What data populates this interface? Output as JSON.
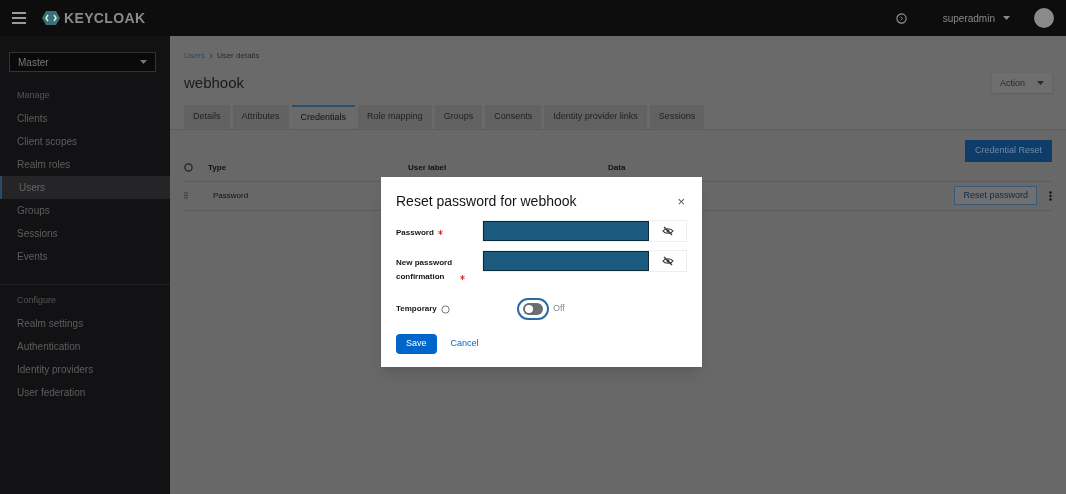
{
  "header": {
    "brand": "KEYCLOAK",
    "user": "superadmin"
  },
  "sidebar": {
    "realm": "Master",
    "sections": [
      {
        "title": "Manage",
        "items": [
          {
            "label": "Clients",
            "selected": false
          },
          {
            "label": "Client scopes",
            "selected": false
          },
          {
            "label": "Realm roles",
            "selected": false
          },
          {
            "label": "Users",
            "selected": true
          },
          {
            "label": "Groups",
            "selected": false
          },
          {
            "label": "Sessions",
            "selected": false
          },
          {
            "label": "Events",
            "selected": false
          }
        ]
      },
      {
        "title": "Configure",
        "items": [
          {
            "label": "Realm settings",
            "selected": false
          },
          {
            "label": "Authentication",
            "selected": false
          },
          {
            "label": "Identity providers",
            "selected": false
          },
          {
            "label": "User federation",
            "selected": false
          }
        ]
      }
    ]
  },
  "breadcrumb": [
    {
      "label": "Users",
      "kind": "link"
    },
    {
      "label": "User details",
      "kind": "current"
    }
  ],
  "page_title": "webhook",
  "action_button": "Action",
  "tabs": [
    {
      "label": "Details",
      "selected": false
    },
    {
      "label": "Attributes",
      "selected": false
    },
    {
      "label": "Credentials",
      "selected": true
    },
    {
      "label": "Role mapping",
      "selected": false
    },
    {
      "label": "Groups",
      "selected": false
    },
    {
      "label": "Consents",
      "selected": false
    },
    {
      "label": "Identity provider links",
      "selected": false
    },
    {
      "label": "Sessions",
      "selected": false
    }
  ],
  "credential_reset_button": "Credential Reset",
  "table": {
    "columns": [
      "Type",
      "User label",
      "Data"
    ],
    "rows": [
      {
        "type": "Password",
        "action": "Reset password"
      }
    ]
  },
  "dialog": {
    "title": "Reset password for webhook",
    "close": "×",
    "fields": [
      {
        "label": "Password",
        "required": true
      },
      {
        "label": "New password confirmation",
        "required": true
      }
    ],
    "temporary": {
      "label": "Temporary",
      "on": false,
      "state_label": "Off"
    },
    "save": "Save",
    "cancel": "Cancel"
  }
}
